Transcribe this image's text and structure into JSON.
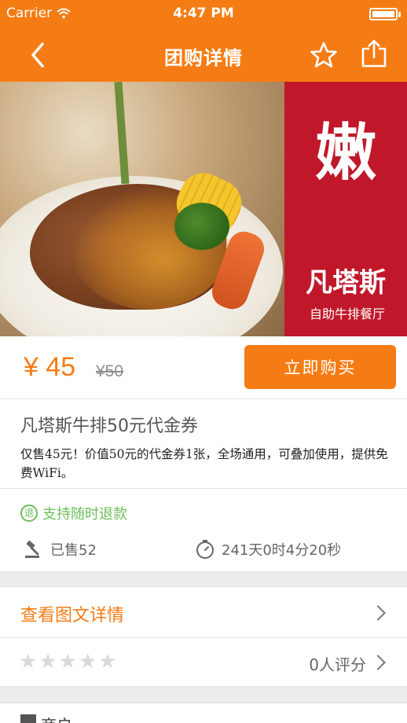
{
  "status_bar": {
    "carrier": "Carrier",
    "time": "4:47 PM"
  },
  "nav": {
    "title": "团购详情",
    "icons": [
      "back-arrow-icon",
      "star-outline-icon",
      "share-icon"
    ]
  },
  "banner": {
    "brand_char": "嫩",
    "brand_name": "凡塔斯",
    "brand_subtitle": "自助牛排餐厅"
  },
  "price": {
    "current": "¥ 45",
    "original": "¥50",
    "buy_label": "立即购买"
  },
  "deal": {
    "title": "凡塔斯牛排50元代金券",
    "description": "仅售45元！价值50元的代金券1张，全场通用，可叠加使用，提供免费WiFi。"
  },
  "perks": {
    "refund_icon_text": "退",
    "refund_label": "支持随时退款",
    "sold_label": "已售52",
    "countdown_label": "241天0时4分20秒"
  },
  "detail_link": {
    "label": "查看图文详情"
  },
  "rating": {
    "stars_filled": 0,
    "stars_total": 5,
    "count_label": "0人评分"
  },
  "shop": {
    "label": "商户"
  },
  "colors": {
    "accent": "#f57c14",
    "refund_green": "#6cbf5a",
    "brand_red": "#c0182a"
  }
}
